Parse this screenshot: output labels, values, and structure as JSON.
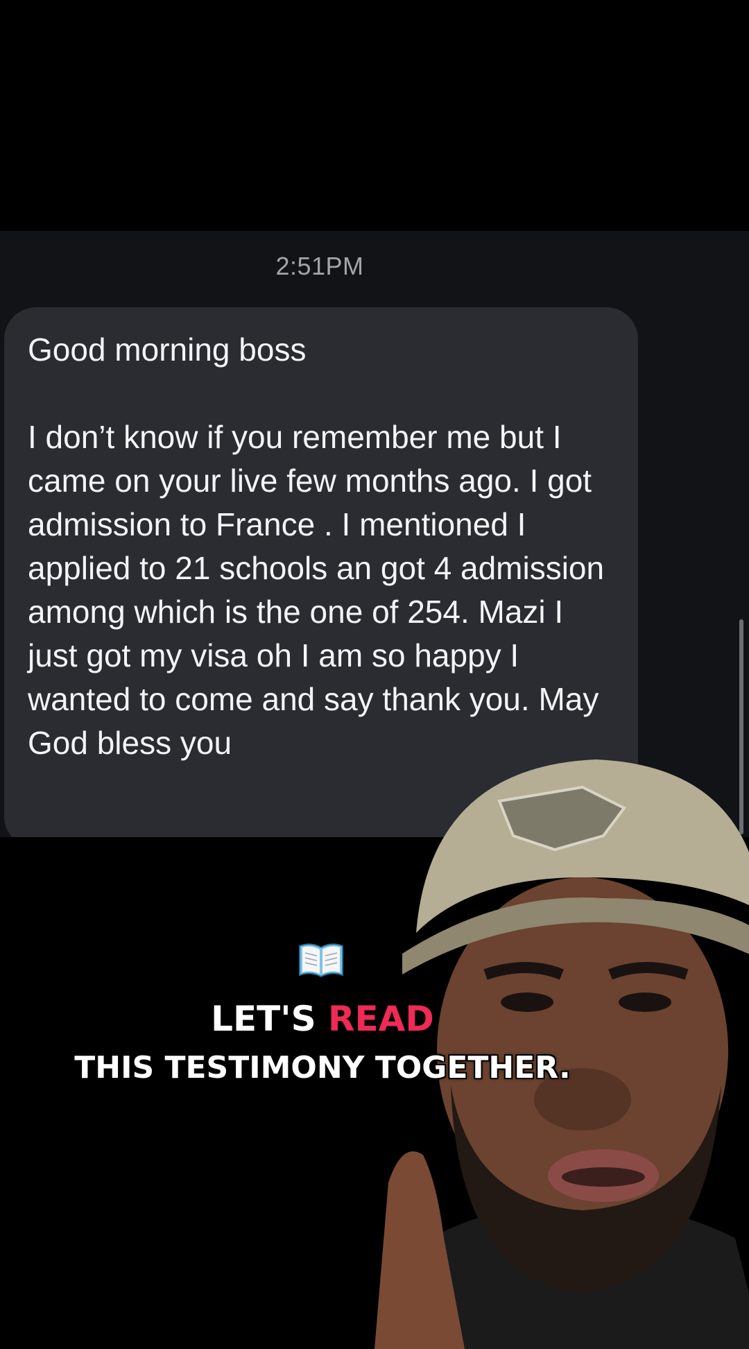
{
  "chat": {
    "timestamp": "2:51PM",
    "message": {
      "greeting": "Good morning boss",
      "body": "I don’t know if you remember me but I came on your live few months ago. I got admission to France . I mentioned I applied to 21 schools an got 4 admission among which is the one of 254. Mazi I just got my visa oh I am so happy I wanted to come and say thank you. May God bless you"
    }
  },
  "caption": {
    "icon": "open-book-icon",
    "line1_prefix": "LET'S ",
    "line1_highlight": "READ",
    "line2": "THIS TESTIMONY TOGETHER.",
    "highlight_color": "#ee2a55"
  },
  "colors": {
    "background": "#000000",
    "chat_background": "#121316",
    "bubble": "#2a2c32",
    "timestamp": "#a3a5ab"
  }
}
